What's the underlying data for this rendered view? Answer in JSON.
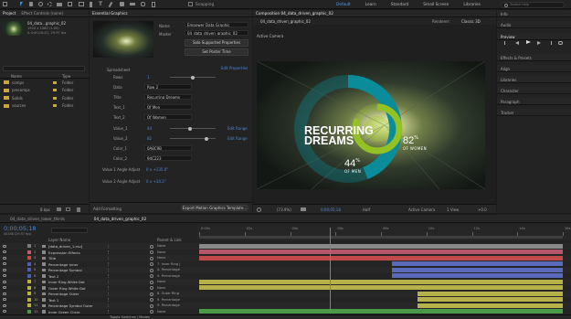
{
  "menubar": {
    "workspaces": [
      "Default",
      "Learn",
      "Standard",
      "Small Screen",
      "Libraries"
    ],
    "snapping": "Snapping",
    "search_placeholder": "Search Help"
  },
  "project": {
    "tabs": [
      "Project",
      "Effect Controls (none)"
    ],
    "selected_name": "04_data...graphic_02",
    "selected_info1": "1920 x 1080 (1.00)",
    "selected_info2": "Δ 0;00;16;01, 29.97 fps",
    "columns": [
      "Name",
      "Type"
    ],
    "items": [
      {
        "name": "comps",
        "type": "Folder"
      },
      {
        "name": "precomps",
        "type": "Folder"
      },
      {
        "name": "Solids",
        "type": "Folder"
      },
      {
        "name": "sources",
        "type": "Folder"
      }
    ],
    "bpc": "8 bpc"
  },
  "essential_graphics": {
    "tab": "Essential Graphics",
    "name_label": "Name",
    "name_value": "Empower Data Graphic",
    "master_label": "Master",
    "master_value": "04_data_driven_graphic_02",
    "solo_button": "Solo Supported Properties",
    "poster_button": "Set Poster Time",
    "group_label": "Spreadsheet",
    "edit_properties": "Edit Properties",
    "props": [
      {
        "label": "Rows",
        "value": "1",
        "slider": 0.5
      },
      {
        "label": "Data",
        "value": "Row 2",
        "dropdown": true
      },
      {
        "label": "Title",
        "value": "Recurring Dreams"
      },
      {
        "label": "Text_1",
        "value": "Of Men"
      },
      {
        "label": "Text_2",
        "value": "Of Women"
      },
      {
        "label": "Value_1",
        "value": "44",
        "slider": 0.44,
        "link": "Edit Range"
      },
      {
        "label": "Value_2",
        "value": "82",
        "slider": 0.82,
        "link": "Edit Range"
      },
      {
        "label": "Color_1",
        "value": "0A8C9B"
      },
      {
        "label": "Color_2",
        "value": "94C223"
      }
    ],
    "angle1_label": "Value 1 Angle Adjust",
    "angle1_value": "0 x +135.0°",
    "angle2_label": "Value 2 Angle Adjust",
    "angle2_value": "0 x +34.2°",
    "add_formatting": "Add Formatting",
    "export_button": "Export Motion Graphics Template..."
  },
  "composition": {
    "tab": "Composition 04_data_driven_graphic_02",
    "subtab": "04_data_driven_graphic_02",
    "renderer_label": "Renderer:",
    "renderer_value": "Classic 3D",
    "active_camera": "Active Camera",
    "title_line1": "RECURRING",
    "title_line2": "DREAMS",
    "value1": "44",
    "text1": "OF MEN",
    "value2": "82",
    "text2": "OF WOMEN",
    "percent": "%",
    "zoom": "(73.9%)",
    "timecode": "0;00;05;18",
    "resolution": "Half",
    "camera": "Active Camera",
    "views": "1 View",
    "exposure": "+0.0",
    "colors": {
      "teal": "#0A8C9B",
      "green": "#94C223"
    },
    "gauge": {
      "value1": 0.44,
      "value2": 0.82
    }
  },
  "right_panels": {
    "items": [
      "Info",
      "Audio",
      "Preview",
      "Effects & Presets",
      "Align",
      "Libraries",
      "Character",
      "Paragraph",
      "Tracker"
    ]
  },
  "timeline": {
    "tabs": [
      "04_data_driven_lower_thirds",
      "04_data_driven_graphic_02"
    ],
    "timecode": "0;00;05;18",
    "frames": "00168 (29.97 fps)",
    "col_layer_name": "Layer Name",
    "col_parent": "Parent & Link",
    "ticks": [
      "0:00s",
      "02s",
      "04s",
      "06s",
      "08s",
      "10s",
      "12s",
      "14s",
      "16s"
    ],
    "toggle_label": "Toggle Switches / Modes",
    "layers": [
      {
        "num": "1",
        "name": "[data_driven_1.csv]",
        "parent": "None",
        "label": "#7c7c7c",
        "bar": "#8a8a8a",
        "start": 0,
        "end": 1
      },
      {
        "num": "2",
        "name": "Expression Effects",
        "parent": "None",
        "label": "#c25b6e",
        "bar": "#b5566a",
        "start": 0,
        "end": 1
      },
      {
        "num": "3",
        "name": "Title",
        "parent": "None",
        "label": "#c94848",
        "bar": "#c34a4a",
        "start": 0,
        "end": 1
      },
      {
        "num": "4",
        "name": "Percentage Inner",
        "parent": "7. Inner Ring |",
        "label": "#4e5fb0",
        "bar": "#5a69b8",
        "start": 0.53,
        "end": 1
      },
      {
        "num": "5",
        "name": "Percentage Symbol",
        "parent": "4. Percentage",
        "label": "#4e5fb0",
        "bar": "#5a69b8",
        "start": 0.53,
        "end": 1
      },
      {
        "num": "6",
        "name": "Text 2",
        "parent": "4. Percentage",
        "label": "#4e5fb0",
        "bar": "#5a69b8",
        "start": 0.53,
        "end": 1
      },
      {
        "num": "7",
        "name": "Inner Ring White Dot",
        "parent": "None",
        "label": "#b9b23e",
        "bar": "#b7b14a",
        "start": 0,
        "end": 1
      },
      {
        "num": "8",
        "name": "Outer Ring White Dot",
        "parent": "None",
        "label": "#b9b23e",
        "bar": "#b7b14a",
        "start": 0,
        "end": 1
      },
      {
        "num": "9",
        "name": "Percentage Outer",
        "parent": "8. Outer Ring",
        "label": "#b9b23e",
        "bar": "#b7b14a",
        "start": 0.6,
        "end": 1
      },
      {
        "num": "10",
        "name": "Text 1",
        "parent": "9. Percentage",
        "label": "#b9b23e",
        "bar": "#b7b14a",
        "start": 0.6,
        "end": 1
      },
      {
        "num": "11",
        "name": "Percentage Symbol Outer",
        "parent": "9. Percentage",
        "label": "#b9b23e",
        "bar": "#b7b14a",
        "start": 0.6,
        "end": 1
      },
      {
        "num": "12",
        "name": "Inner Green Circle",
        "parent": "None",
        "label": "#4a9a4a",
        "bar": "#4a9a4a",
        "start": 0,
        "end": 1
      }
    ],
    "playhead": 0.36
  }
}
